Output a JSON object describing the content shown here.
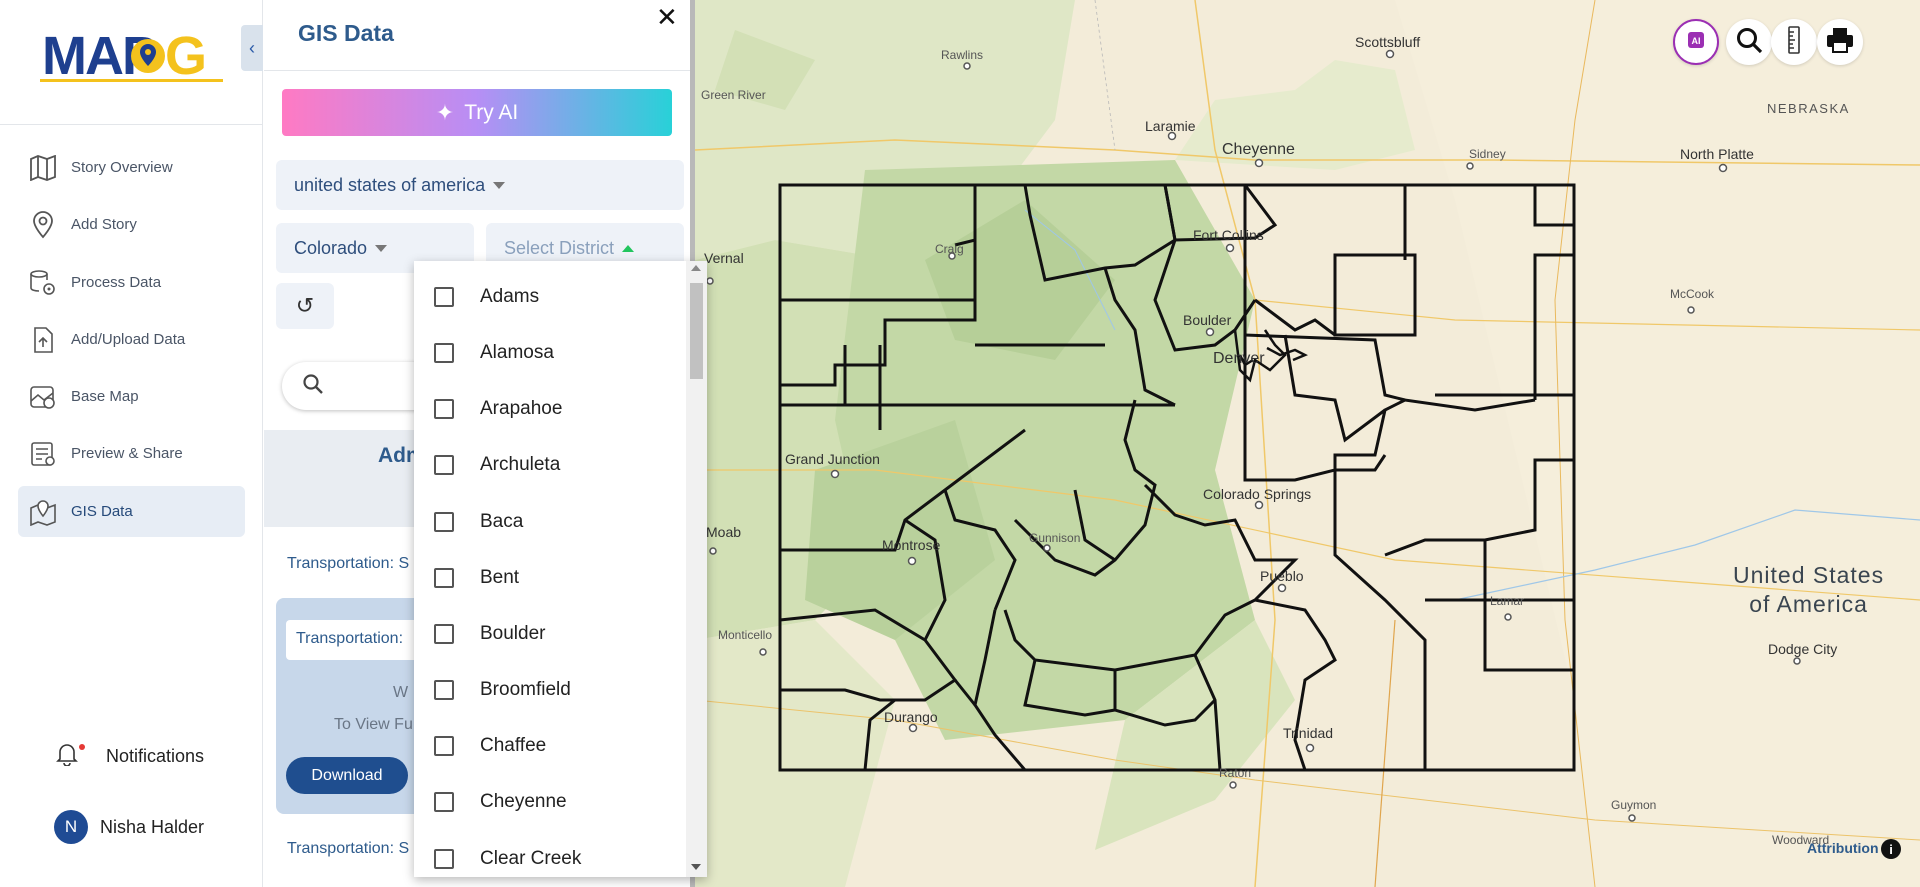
{
  "brand": {
    "logo_text": "MAPOG"
  },
  "nav": {
    "items": [
      {
        "label": "Story Overview",
        "icon": "map-icon"
      },
      {
        "label": "Add Story",
        "icon": "pin-icon"
      },
      {
        "label": "Process Data",
        "icon": "gear-stack-icon"
      },
      {
        "label": "Add/Upload Data",
        "icon": "upload-icon"
      },
      {
        "label": "Base Map",
        "icon": "basemap-icon"
      },
      {
        "label": "Preview & Share",
        "icon": "preview-icon"
      },
      {
        "label": "GIS Data",
        "icon": "gis-data-icon",
        "active": true
      }
    ],
    "notifications_label": "Notifications",
    "user": {
      "initial": "N",
      "name": "Nisha Halder"
    }
  },
  "panel": {
    "title": "GIS Data",
    "try_ai_label": "Try AI",
    "country": "united states of america",
    "state": "Colorado",
    "district_placeholder": "Select District",
    "section_heading_partial": "Adm",
    "transport_1": "Transportation: S",
    "card_label": "Transportation:",
    "card_text_w": "W",
    "card_text_view": "To View Fu",
    "download_label": "Download",
    "transport_2": "Transportation: S"
  },
  "district_dropdown": {
    "options": [
      "Adams",
      "Alamosa",
      "Arapahoe",
      "Archuleta",
      "Baca",
      "Bent",
      "Boulder",
      "Broomfield",
      "Chaffee",
      "Cheyenne",
      "Clear Creek"
    ]
  },
  "map": {
    "places": {
      "scottsbluff": "Scottsbluff",
      "rawlins": "Rawlins",
      "green_river": "Green River",
      "laramie": "Laramie",
      "cheyenne": "Cheyenne",
      "sidney": "Sidney",
      "north_platte": "North Platte",
      "nebraska": "NEBRASKA",
      "fort_collins": "Fort Collins",
      "craig": "Craig",
      "vernal": "Vernal",
      "boulder": "Boulder",
      "denver": "Denver",
      "mccook": "McCook",
      "grand_junction": "Grand Junction",
      "colorado_springs": "Colorado Springs",
      "moab": "Moab",
      "montrose": "Montrose",
      "gunnison": "Gunnison",
      "pueblo": "Pueblo",
      "lamar": "Lamar",
      "usa_line1": "United States",
      "usa_line2": "of America",
      "dodge_city": "Dodge City",
      "monticello": "Monticello",
      "durango": "Durango",
      "trinidad": "Trinidad",
      "raton": "Raton",
      "guymon": "Guymon",
      "woodward": "Woodward"
    },
    "attribution_label": "Attribution",
    "info_label": "i"
  }
}
